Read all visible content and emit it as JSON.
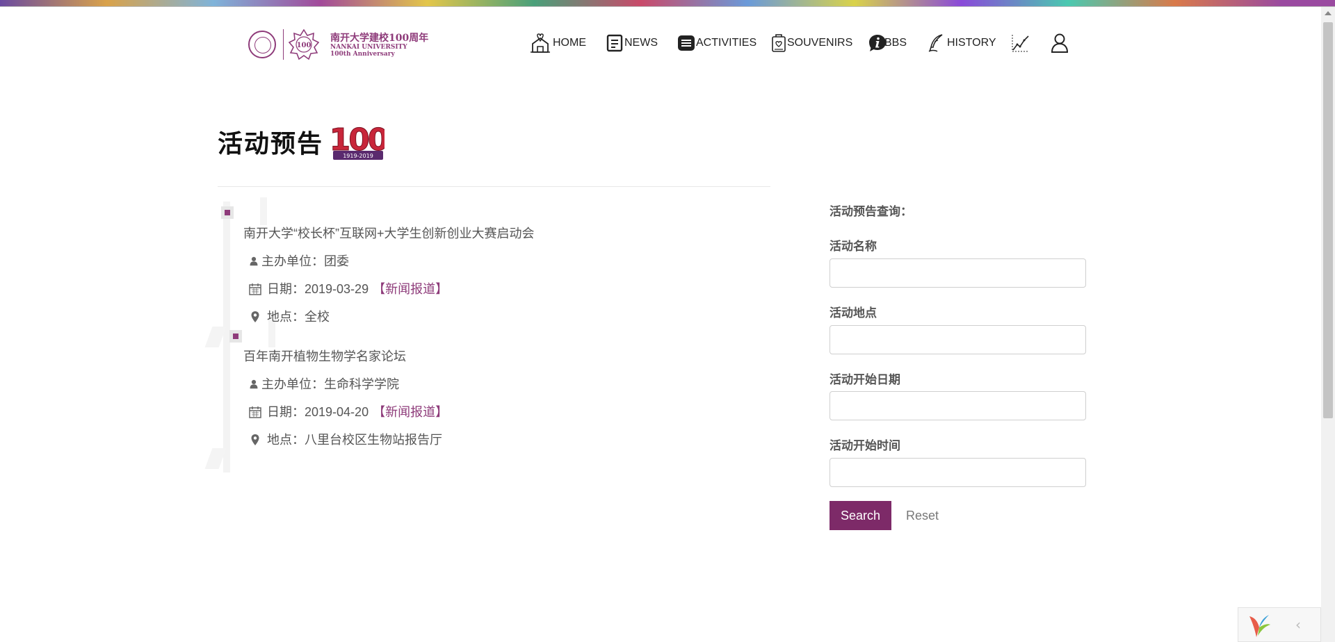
{
  "header": {
    "logo": {
      "cn": "南开大学建校100周年",
      "en_line1": "NANKAI UNIVERSITY",
      "en_line2": "100th Anniversary",
      "badge_number": "100"
    },
    "nav": [
      {
        "label": "HOME",
        "icon": "home-icon"
      },
      {
        "label": "NEWS",
        "icon": "news-icon"
      },
      {
        "label": "ACTIVITIES",
        "icon": "activities-icon"
      },
      {
        "label": "SOUVENIRS",
        "icon": "souvenirs-icon"
      },
      {
        "label": "BBS",
        "icon": "info-icon"
      },
      {
        "label": "HISTORY",
        "icon": "quill-icon"
      },
      {
        "label": "",
        "icon": "chart-icon"
      },
      {
        "label": "",
        "icon": "user-icon"
      }
    ]
  },
  "page": {
    "title": "活动预告",
    "badge_number": "100",
    "badge_years": "1919-2019"
  },
  "events": [
    {
      "title": "南开大学“校长杯”互联网+大学生创新创业大赛启动会",
      "organizer": "主办单位：团委",
      "date_label": "日期：",
      "date": "2019-03-29",
      "news_link": "【新闻报道】",
      "location": "地点：全校"
    },
    {
      "title": "百年南开植物生物学名家论坛",
      "organizer": "主办单位：生命科学学院",
      "date_label": "日期：",
      "date": "2019-04-20",
      "news_link": "【新闻报道】",
      "location": "地点：八里台校区生物站报告厅"
    }
  ],
  "search_form": {
    "heading": "活动预告查询：",
    "fields": [
      {
        "label": "活动名称",
        "value": "",
        "placeholder": ""
      },
      {
        "label": "活动地点",
        "value": "",
        "placeholder": ""
      },
      {
        "label": "活动开始日期",
        "value": "",
        "placeholder": ""
      },
      {
        "label": "活动开始时间",
        "value": "",
        "placeholder": ""
      }
    ],
    "search_label": "Search",
    "reset_label": "Reset"
  },
  "colors": {
    "brand": "#7d2a68",
    "link": "#8e3b7a"
  }
}
